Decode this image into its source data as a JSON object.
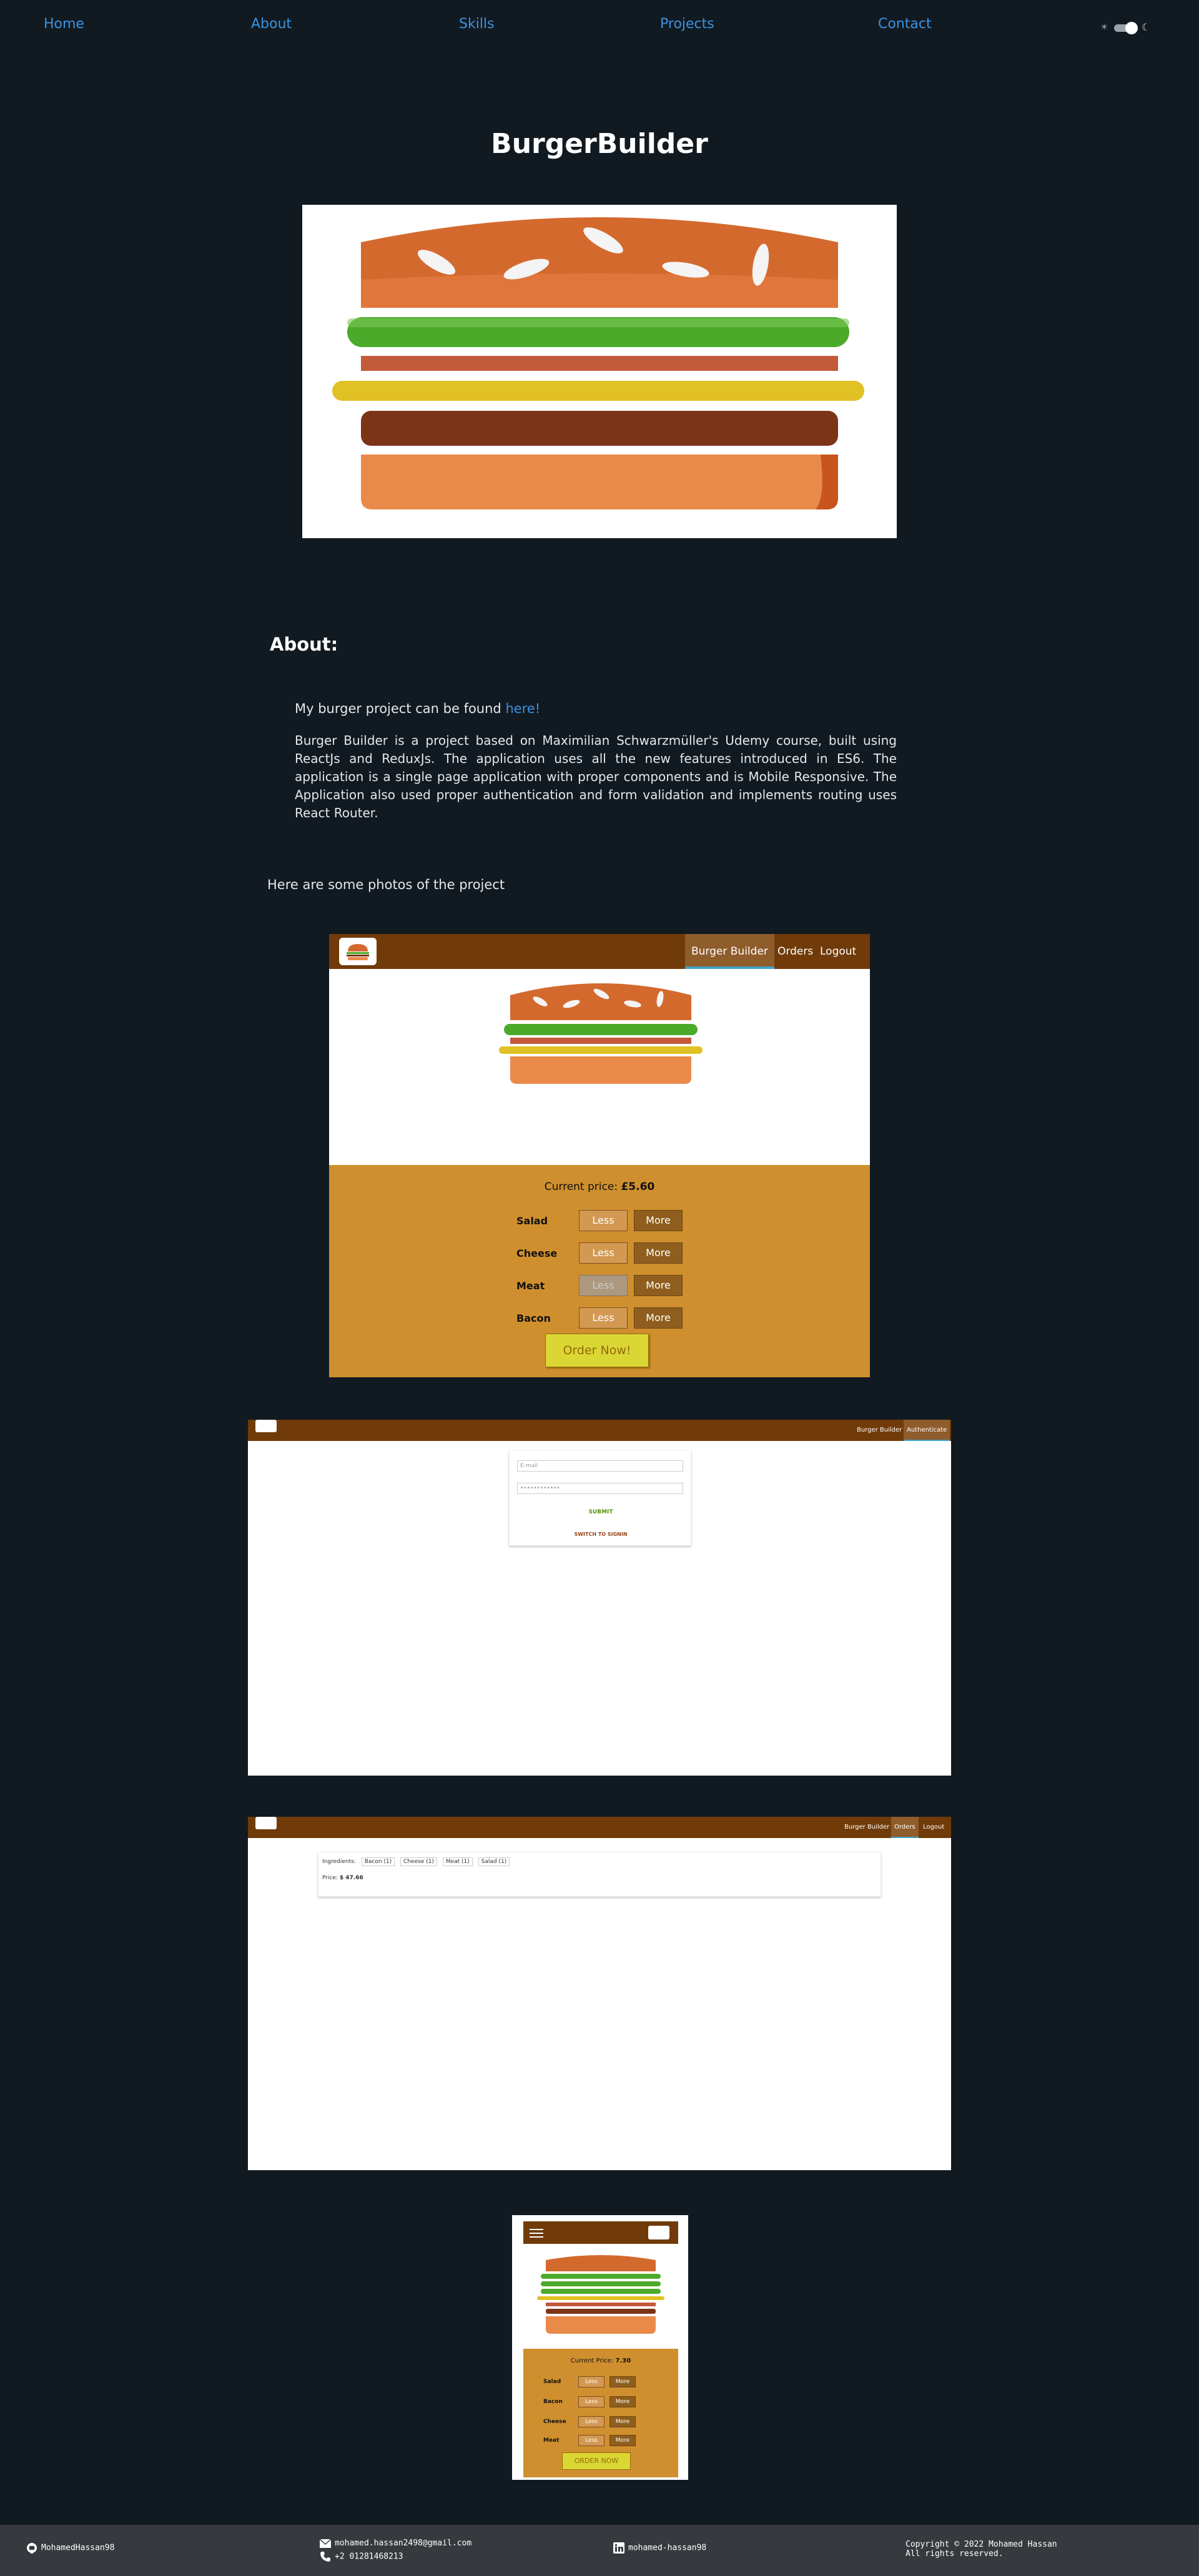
{
  "nav": {
    "items": [
      "Home",
      "About",
      "Skills",
      "Projects",
      "Contact"
    ],
    "theme_toggle": {
      "left_icon": "sun-icon",
      "right_icon": "moon-icon"
    }
  },
  "project": {
    "title": "BurgerBuilder"
  },
  "about": {
    "heading": "About:",
    "link_prefix": "My burger project can be found",
    "link_text": "here!",
    "description": "Burger Builder is a project based on Maximilian Schwarzmüller's Udemy course, built using ReactJs and ReduxJs. The application uses all the new features introduced in ES6. The application is a single page application with proper components and is Mobile Responsive. The Application also used proper authentication and form validation and implements routing uses React Router."
  },
  "photos_heading": "Here are some photos of the project",
  "shot1": {
    "nav": [
      "Burger Builder",
      "Orders",
      "Logout"
    ],
    "price_label": "Current price:",
    "price_value": "£5.60",
    "ingredients": [
      {
        "label": "Salad",
        "less": "Less",
        "more": "More",
        "less_disabled": false
      },
      {
        "label": "Cheese",
        "less": "Less",
        "more": "More",
        "less_disabled": false
      },
      {
        "label": "Meat",
        "less": "Less",
        "more": "More",
        "less_disabled": true
      },
      {
        "label": "Bacon",
        "less": "Less",
        "more": "More",
        "less_disabled": false
      }
    ],
    "order_button": "Order Now!"
  },
  "shot2": {
    "nav": [
      "Burger Builder",
      "Authenticate"
    ],
    "email_placeholder": "E-mail",
    "password_value": "••••••••••••",
    "submit": "SUBMIT",
    "switch": "SWITCH TO SIGNIN"
  },
  "shot3": {
    "nav": [
      "Burger Builder",
      "Orders",
      "Logout"
    ],
    "ingredients_label": "Ingredients:",
    "chips": [
      "Bacon (1)",
      "Cheese (1)",
      "Meat (1)",
      "Salad (1)"
    ],
    "price_label": "Price:",
    "price_value": "$ 47.66"
  },
  "shot4": {
    "price_label": "Current Price:",
    "price_value": "7.30",
    "ingredients": [
      "Salad",
      "Bacon",
      "Cheese",
      "Meat"
    ],
    "less": "Less",
    "more": "More",
    "order_button": "ORDER NOW"
  },
  "footer": {
    "github": "MohamedHassan98",
    "email": "mohamed.hassan2498@gmail.com",
    "phone": "+2 01281468213",
    "linkedin": "mohamed-hassan98",
    "copyright_line1": "Copyright © 2022 Mohamed Hassan",
    "copyright_line2": "All rights reserved."
  },
  "colors": {
    "background": "#121a21",
    "link": "#3a93e0",
    "toolbar": "#703b09",
    "controls": "#cf8f2e",
    "order_button": "#dad735",
    "footer": "#363a3e"
  }
}
